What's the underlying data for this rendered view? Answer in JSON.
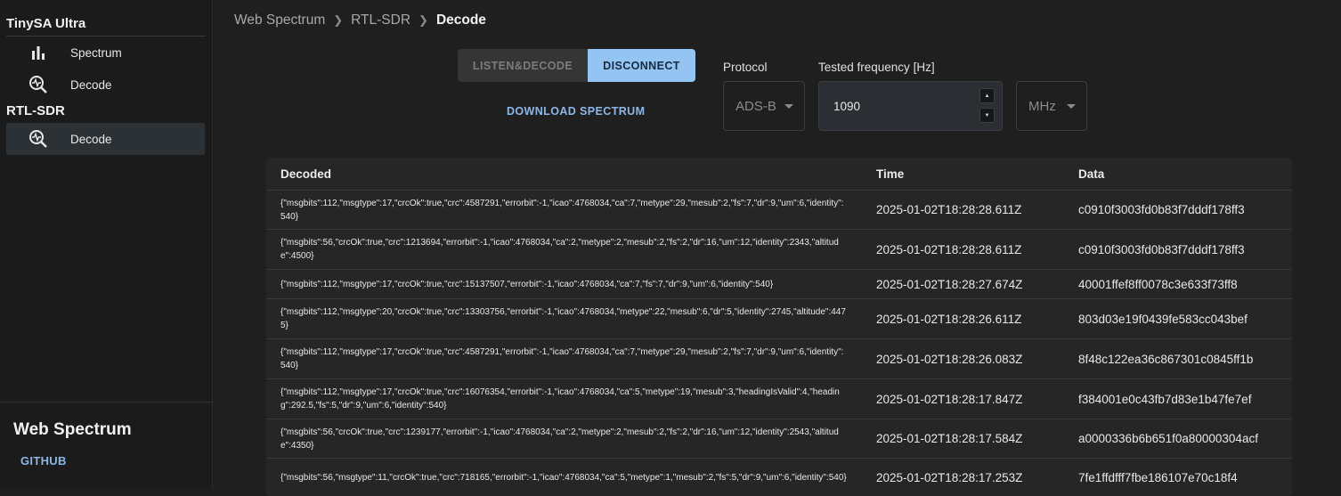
{
  "sidebar": {
    "section1": "TinySA Ultra",
    "items1": [
      {
        "label": "Spectrum",
        "icon": "bar-chart-icon"
      },
      {
        "label": "Decode",
        "icon": "decode-search-icon"
      }
    ],
    "section2": "RTL-SDR",
    "items2": [
      {
        "label": "Decode",
        "icon": "decode-search-icon",
        "active": true
      }
    ],
    "brand": "Web Spectrum",
    "github": "GITHUB"
  },
  "breadcrumb": [
    "Web Spectrum",
    "RTL-SDR",
    "Decode"
  ],
  "controls": {
    "listen": "LISTEN&DECODE",
    "disconnect": "DISCONNECT",
    "download": "DOWNLOAD SPECTRUM",
    "protocol_label": "Protocol",
    "protocol_value": "ADS-B",
    "freq_label": "Tested frequency [Hz]",
    "freq_value": "1090",
    "unit_value": "MHz"
  },
  "table": {
    "headers": {
      "decoded": "Decoded",
      "time": "Time",
      "data": "Data"
    },
    "rows": [
      {
        "decoded": "{\"msgbits\":112,\"msgtype\":17,\"crcOk\":true,\"crc\":4587291,\"errorbit\":-1,\"icao\":4768034,\"ca\":7,\"metype\":29,\"mesub\":2,\"fs\":7,\"dr\":9,\"um\":6,\"identity\":540}",
        "time": "2025-01-02T18:28:28.611Z",
        "data": "c0910f3003fd0b83f7dddf178ff3"
      },
      {
        "decoded": "{\"msgbits\":56,\"crcOk\":true,\"crc\":1213694,\"errorbit\":-1,\"icao\":4768034,\"ca\":2,\"metype\":2,\"mesub\":2,\"fs\":2,\"dr\":16,\"um\":12,\"identity\":2343,\"altitude\":4500}",
        "time": "2025-01-02T18:28:28.611Z",
        "data": "c0910f3003fd0b83f7dddf178ff3"
      },
      {
        "decoded": "{\"msgbits\":112,\"msgtype\":17,\"crcOk\":true,\"crc\":15137507,\"errorbit\":-1,\"icao\":4768034,\"ca\":7,\"fs\":7,\"dr\":9,\"um\":6,\"identity\":540}",
        "time": "2025-01-02T18:28:27.674Z",
        "data": "40001ffef8ff0078c3e633f73ff8"
      },
      {
        "decoded": "{\"msgbits\":112,\"msgtype\":20,\"crcOk\":true,\"crc\":13303756,\"errorbit\":-1,\"icao\":4768034,\"metype\":22,\"mesub\":6,\"dr\":5,\"identity\":2745,\"altitude\":4475}",
        "time": "2025-01-02T18:28:26.611Z",
        "data": "803d03e19f0439fe583cc043bef"
      },
      {
        "decoded": "{\"msgbits\":112,\"msgtype\":17,\"crcOk\":true,\"crc\":4587291,\"errorbit\":-1,\"icao\":4768034,\"ca\":7,\"metype\":29,\"mesub\":2,\"fs\":7,\"dr\":9,\"um\":6,\"identity\":540}",
        "time": "2025-01-02T18:28:26.083Z",
        "data": "8f48c122ea36c867301c0845ff1b"
      },
      {
        "decoded": "{\"msgbits\":112,\"msgtype\":17,\"crcOk\":true,\"crc\":16076354,\"errorbit\":-1,\"icao\":4768034,\"ca\":5,\"metype\":19,\"mesub\":3,\"headingIsValid\":4,\"heading\":292.5,\"fs\":5,\"dr\":9,\"um\":6,\"identity\":540}",
        "time": "2025-01-02T18:28:17.847Z",
        "data": "f384001e0c43fb7d83e1b47fe7ef"
      },
      {
        "decoded": "{\"msgbits\":56,\"crcOk\":true,\"crc\":1239177,\"errorbit\":-1,\"icao\":4768034,\"ca\":2,\"metype\":2,\"mesub\":2,\"fs\":2,\"dr\":16,\"um\":12,\"identity\":2543,\"altitude\":4350}",
        "time": "2025-01-02T18:28:17.584Z",
        "data": "a0000336b6b651f0a80000304acf"
      },
      {
        "decoded": "{\"msgbits\":56,\"msgtype\":11,\"crcOk\":true,\"crc\":718165,\"errorbit\":-1,\"icao\":4768034,\"ca\":5,\"metype\":1,\"mesub\":2,\"fs\":5,\"dr\":9,\"um\":6,\"identity\":540}",
        "time": "2025-01-02T18:28:17.253Z",
        "data": "7fe1ffdfff7fbe186107e70c18f4"
      }
    ]
  }
}
